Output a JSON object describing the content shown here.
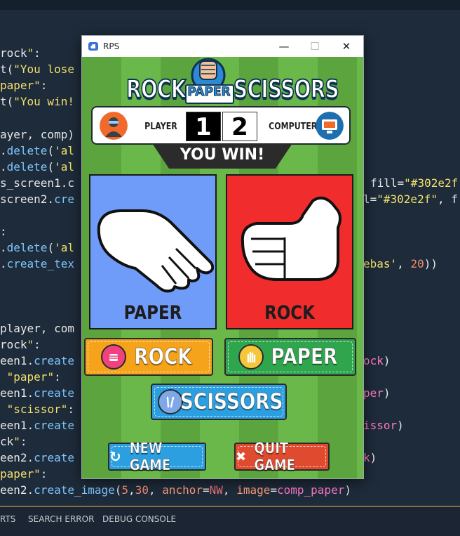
{
  "editor": {
    "status_items": [
      "RTS",
      "SEARCH ERROR",
      "DEBUG CONSOLE"
    ]
  },
  "window": {
    "title": "RPS",
    "minimize": "—",
    "maximize": "☐",
    "close": "✕"
  },
  "logo": {
    "left_word": "ROCK",
    "center_word": "PAPER",
    "right_word": "SCISSORS"
  },
  "scoreboard": {
    "player_label": "PLAYER",
    "player_score": "1",
    "computer_score": "2",
    "computer_label": "COMPUTER"
  },
  "result": "YOU WIN!",
  "player_card": {
    "label": "PAPER",
    "color": "#6f9cf8",
    "icon": "paper-hand-icon"
  },
  "computer_card": {
    "label": "ROCK",
    "color": "#f02c2c",
    "icon": "rock-fist-icon"
  },
  "buttons": {
    "rock": {
      "label": "ROCK",
      "color": "#f5a31a"
    },
    "paper": {
      "label": "PAPER",
      "color": "#2fa64e"
    },
    "scissors": {
      "label": "SCISSORS",
      "color": "#2b9fe0"
    },
    "new_game": {
      "label": "NEW GAME",
      "color": "#2b9fe0"
    },
    "quit_game": {
      "label": "QUIT GAME",
      "color": "#e04a2f"
    }
  },
  "colors": {
    "field_dark": "#5ca53e",
    "field_light": "#6bb84a",
    "banner": "#2c2b2b"
  }
}
